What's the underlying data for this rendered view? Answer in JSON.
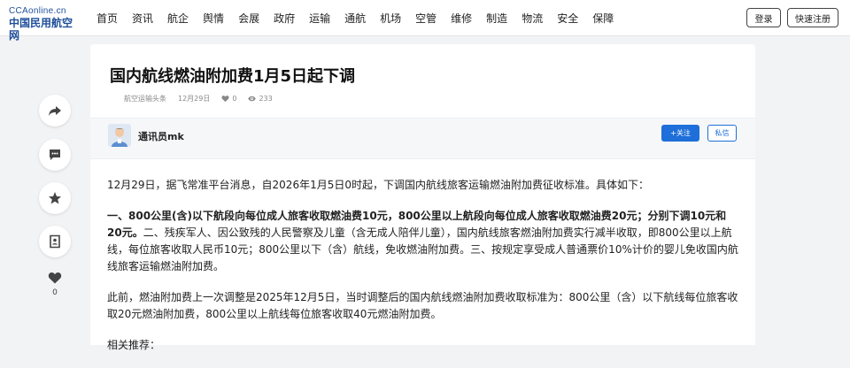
{
  "header": {
    "logo_en": "CCAonline.cn",
    "logo_cn": "中国民用航空网",
    "nav": [
      "首页",
      "资讯",
      "航企",
      "舆情",
      "会展",
      "政府",
      "运输",
      "通航",
      "机场",
      "空管",
      "维修",
      "制造",
      "物流",
      "安全",
      "保障"
    ],
    "login_label": "登录",
    "register_label": "快速注册"
  },
  "side": {
    "like_count": "0"
  },
  "article": {
    "title": "国内航线燃油附加费1月5日起下调",
    "source": "航空运输头条",
    "date": "12月29日",
    "likes": "0",
    "views": "233",
    "author_name": "通讯员mk",
    "follow_label": "+关注",
    "message_label": "私信",
    "para1": "12月29日，据飞常准平台消息，自2026年1月5日0时起，下调国内航线旅客运输燃油附加费征收标准。具体如下：",
    "para2_bold": "一、800公里(含)以下航段向每位成人旅客收取燃油费10元，800公里以上航段向每位成人旅客收取燃油费20元；分别下调10元和20元。",
    "para2_rest": "二、残疾军人、因公致残的人民警察及儿童（含无成人陪伴儿童），国内航线旅客燃油附加费实行减半收取，即800公里以上航线，每位旅客收取人民币10元；800公里以下（含）航线，免收燃油附加费。三、按规定享受成人普通票价10%计价的婴儿免收国内航线旅客运输燃油附加费。",
    "para3": "此前，燃油附加费上一次调整是2025年12月5日，当时调整后的国内航线燃油附加费收取标准为：800公里（含）以下航线每位旅客收取20元燃油附加费，800公里以上航线每位旅客收取40元燃油附加费。",
    "related": "相关推荐："
  }
}
